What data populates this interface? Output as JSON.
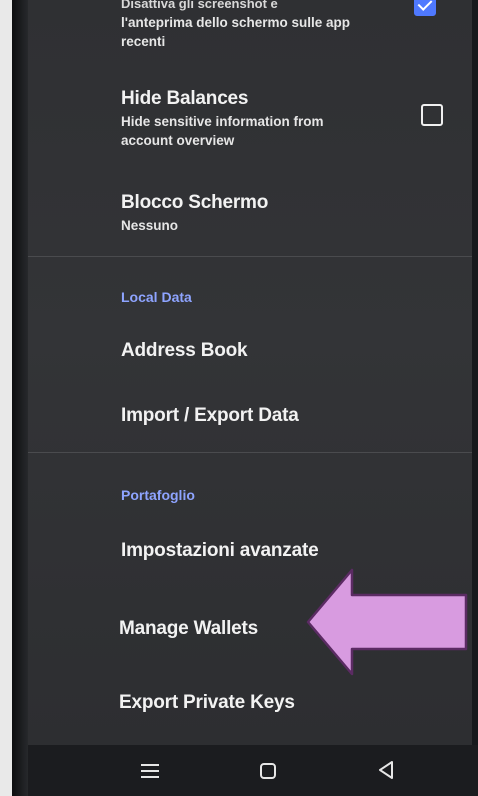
{
  "settings": {
    "screenshot_item": {
      "title": "Disattiva gli screenshot e",
      "subtitle_line1": "l'anteprima dello schermo sulle app",
      "subtitle_line2": "recenti",
      "checked": true
    },
    "hide_balances": {
      "title": "Hide Balances",
      "subtitle_line1": "Hide sensitive information from",
      "subtitle_line2": "account overview",
      "checked": false
    },
    "screen_lock": {
      "title": "Blocco Schermo",
      "value": "Nessuno"
    }
  },
  "local_data": {
    "header": "Local Data",
    "address_book": "Address Book",
    "import_export": "Import / Export Data"
  },
  "wallet": {
    "header": "Portafoglio",
    "advanced": "Impostazioni avanzate",
    "manage_wallets": "Manage Wallets",
    "export_keys": "Export Private Keys"
  },
  "navbar": {
    "menu_icon": "menu-icon",
    "home_icon": "home-icon",
    "back_icon": "back-icon"
  },
  "colors": {
    "accent": "#8ea4ff",
    "checkbox_checked": "#4f79ff",
    "annotation_arrow": "#d89be0"
  }
}
